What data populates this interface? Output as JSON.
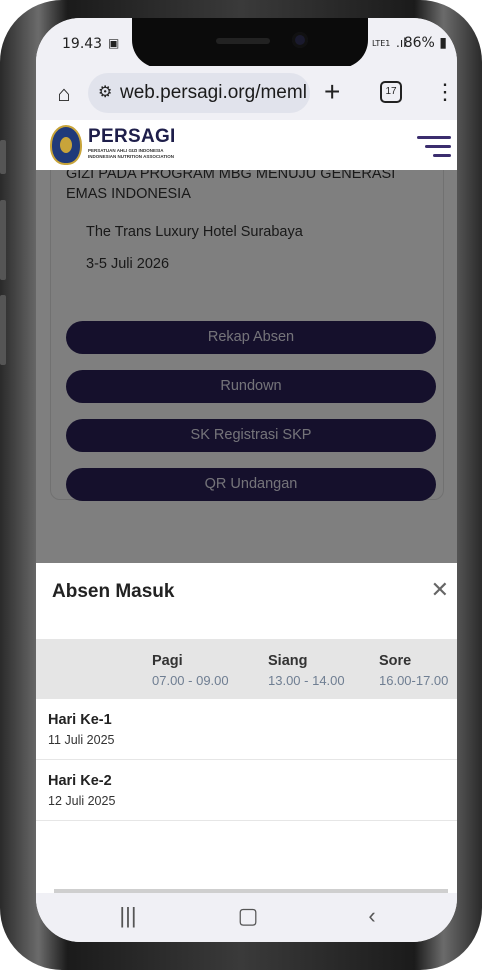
{
  "status_bar": {
    "time": "19.43",
    "network": "LTE1",
    "battery": "86%"
  },
  "browser": {
    "url": "web.persagi.org/meml",
    "tab_count": "17"
  },
  "site": {
    "brand": "PERSAGI",
    "brand_sub_1": "PERSATUAN AHLI GIZI INDONESIA",
    "brand_sub_2": "INDONESIAN NUTRITION ASSOCIATION"
  },
  "event": {
    "title": "GIZI PADA PROGRAM MBG MENUJU GENERASI EMAS INDONESIA",
    "venue": "The Trans Luxury Hotel Surabaya",
    "date": "3-5 Juli 2026",
    "buttons": [
      "Rekap Absen",
      "Rundown",
      "SK Registrasi SKP",
      "QR Undangan"
    ]
  },
  "modal": {
    "title": "Absen Masuk",
    "columns": [
      {
        "name": "Pagi",
        "time": "07.00 - 09.00"
      },
      {
        "name": "Siang",
        "time": "13.00 - 14.00"
      },
      {
        "name": "Sore",
        "time": "16.00-17.00"
      }
    ],
    "rows": [
      {
        "day": "Hari Ke-1",
        "date": "11 Juli 2025"
      },
      {
        "day": "Hari Ke-2",
        "date": "12 Juli 2025"
      }
    ]
  },
  "colors": {
    "button_bg": "#2a2158",
    "accent": "#3b2d6e"
  }
}
